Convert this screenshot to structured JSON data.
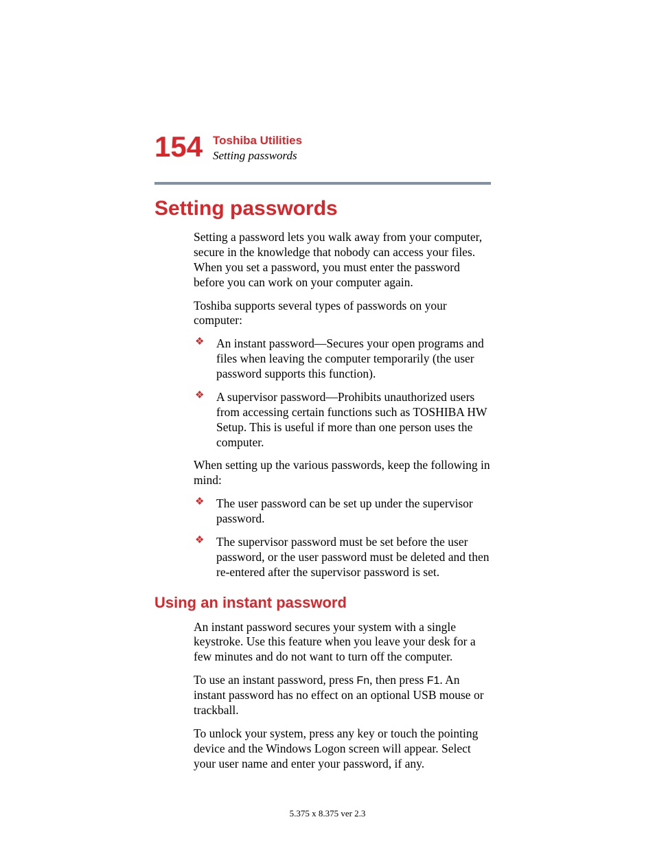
{
  "header": {
    "page_number": "154",
    "chapter": "Toshiba Utilities",
    "section_crumb": "Setting passwords"
  },
  "main": {
    "heading": "Setting passwords",
    "intro_1": "Setting a password lets you walk away from your computer, secure in the knowledge that nobody can access your files. When you set a password, you must enter the password before you can work on your computer again.",
    "intro_2": "Toshiba supports several types of passwords on your computer:",
    "types": [
      "An instant password—Secures your open programs and files when leaving the computer temporarily (the user password supports this function).",
      "A supervisor password—Prohibits unauthorized users from accessing certain functions such as TOSHIBA HW Setup. This is useful if more than one person uses the computer."
    ],
    "setup_note": "When setting up the various passwords, keep the following in mind:",
    "rules": [
      "The user password can be set up under the supervisor password.",
      "The supervisor password must be set before the user password, or the user password must be deleted and then re-entered after the supervisor password is set."
    ],
    "sub_heading": "Using an instant password",
    "instant_1": "An instant password secures your system with a single keystroke. Use this feature when you leave your desk for a few minutes and do not want to turn off the computer.",
    "instant_2_pre": "To use an instant password, press ",
    "instant_2_key1": "Fn",
    "instant_2_mid": ", then press ",
    "instant_2_key2": "F1",
    "instant_2_post": ". An instant password has no effect on an optional USB mouse or trackball.",
    "instant_3": "To unlock your system, press any key or touch the pointing device and the Windows Logon screen will appear. Select your user name and enter your password, if any."
  },
  "footer": {
    "text": "5.375 x 8.375 ver 2.3"
  },
  "bullet_glyph": "❖"
}
